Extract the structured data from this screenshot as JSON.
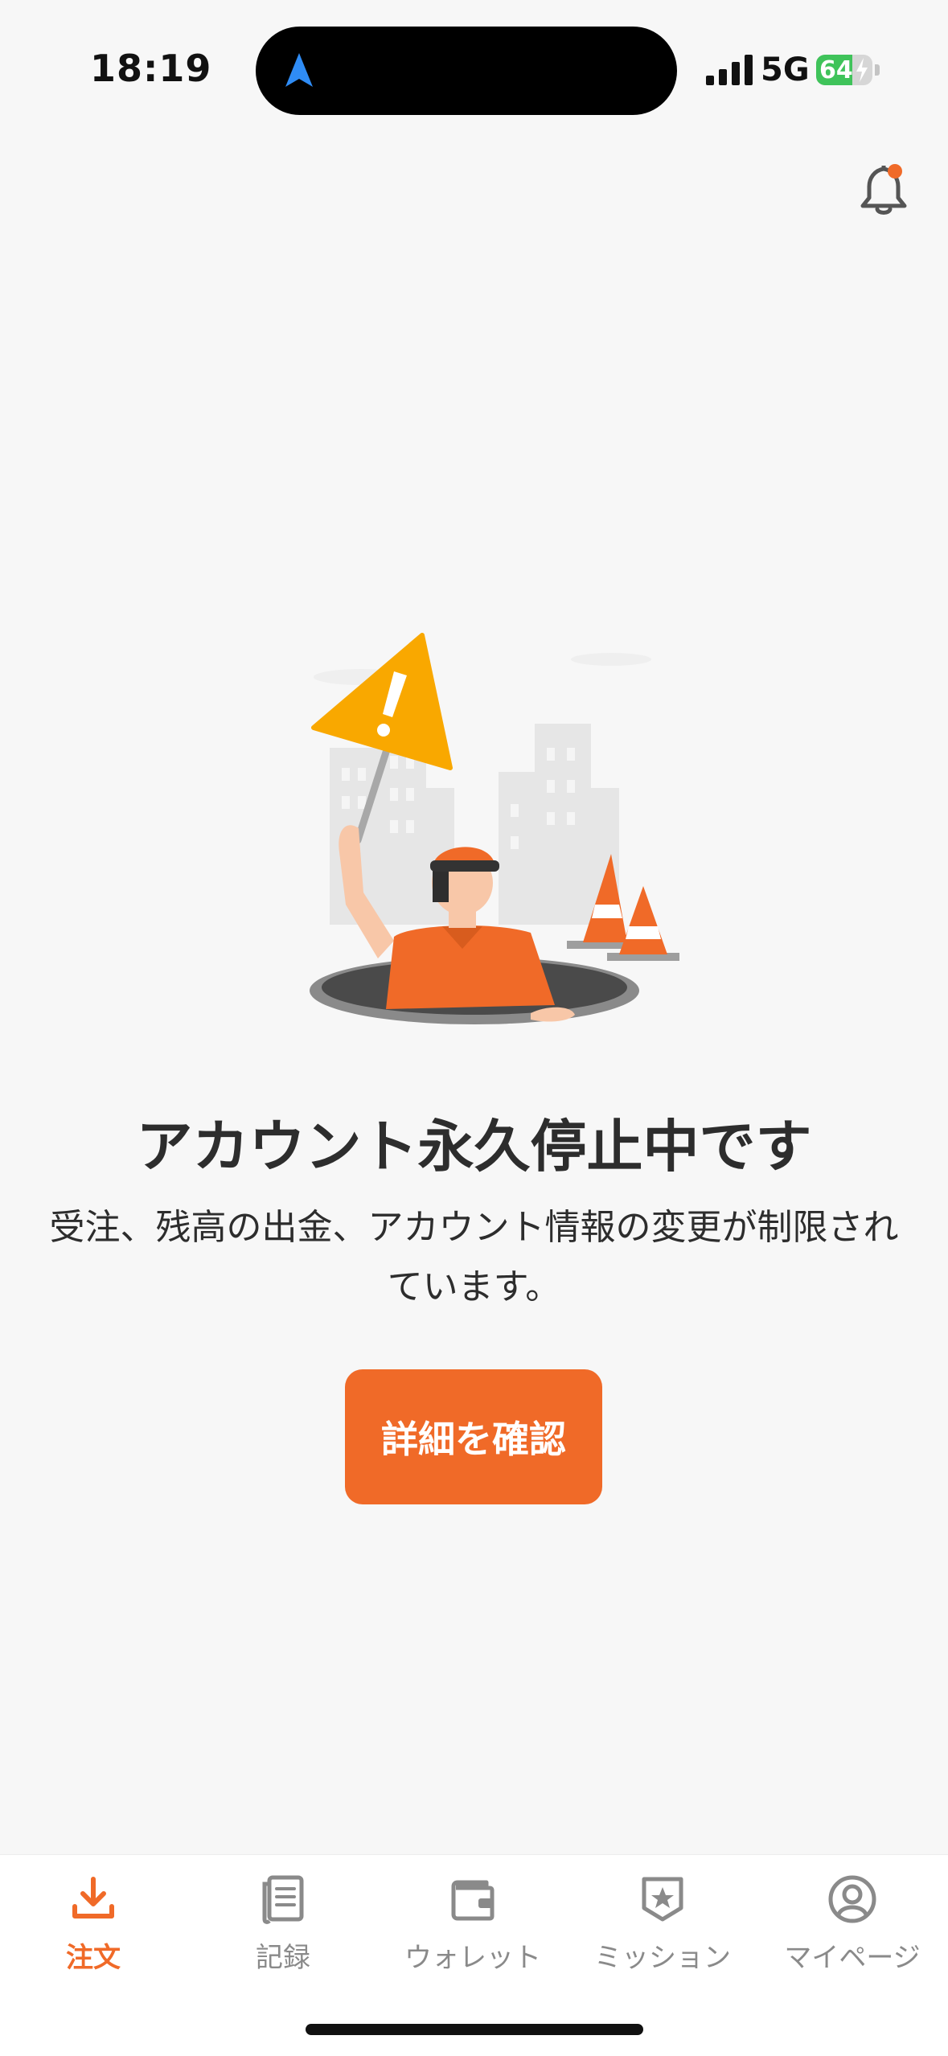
{
  "status_bar": {
    "time": "18:19",
    "network": "5G",
    "battery_level": 64,
    "battery_text": "64",
    "location_arrow_color": "#2f8cf5",
    "battery_color": "#3fc35a"
  },
  "header": {
    "notification_icon": "bell-icon",
    "has_unread": true
  },
  "main": {
    "illustration": "worker-warning-sign-illustration",
    "title": "アカウント永久停止中です",
    "description_line1": "受注、残高の出金、アカウント情報の変更が制限され",
    "description_line2": "ています。",
    "button_label": "詳細を確認"
  },
  "tabbar": {
    "items": [
      {
        "label": "注文",
        "icon": "download-tray-icon",
        "active": true
      },
      {
        "label": "記録",
        "icon": "document-icon",
        "active": false
      },
      {
        "label": "ウォレット",
        "icon": "wallet-icon",
        "active": false
      },
      {
        "label": "ミッション",
        "icon": "star-badge-icon",
        "active": false
      },
      {
        "label": "マイページ",
        "icon": "user-circle-icon",
        "active": false
      }
    ]
  },
  "colors": {
    "accent": "#f06a28",
    "background": "#f7f7f7",
    "inactive_tab": "#8a8a8a"
  }
}
